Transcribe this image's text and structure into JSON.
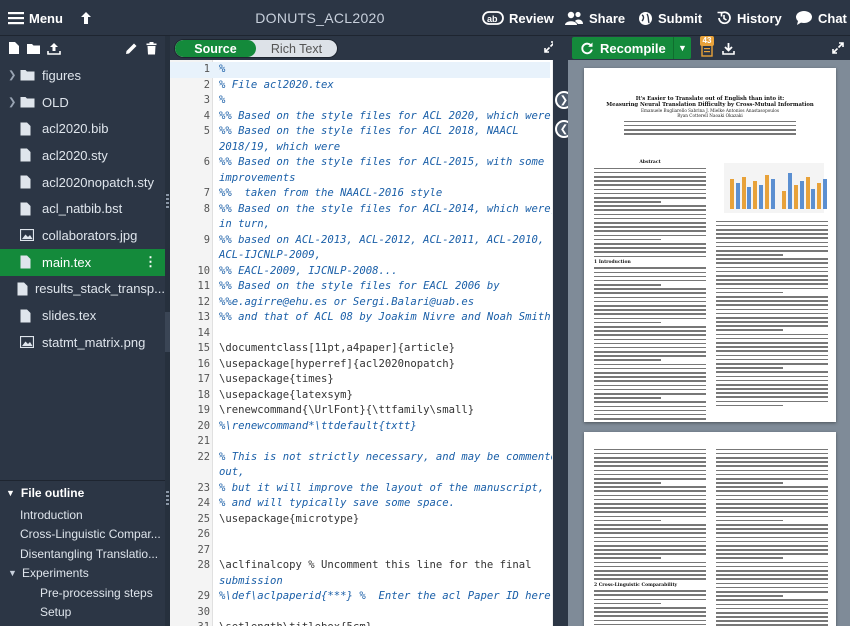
{
  "topbar": {
    "menu_label": "Menu",
    "project_title": "DONUTS_ACL2020",
    "review_label": "Review",
    "share_label": "Share",
    "submit_label": "Submit",
    "history_label": "History",
    "chat_label": "Chat"
  },
  "files": [
    {
      "name": "figures",
      "type": "folder"
    },
    {
      "name": "OLD",
      "type": "folder"
    },
    {
      "name": "acl2020.bib",
      "type": "file"
    },
    {
      "name": "acl2020.sty",
      "type": "file"
    },
    {
      "name": "acl2020nopatch.sty",
      "type": "file"
    },
    {
      "name": "acl_natbib.bst",
      "type": "file"
    },
    {
      "name": "collaborators.jpg",
      "type": "image"
    },
    {
      "name": "main.tex",
      "type": "file",
      "active": true
    },
    {
      "name": "results_stack_transp...",
      "type": "file"
    },
    {
      "name": "slides.tex",
      "type": "file"
    },
    {
      "name": "statmt_matrix.png",
      "type": "image"
    }
  ],
  "outline": {
    "title": "File outline",
    "items": [
      {
        "label": "Introduction",
        "level": 1
      },
      {
        "label": "Cross-Linguistic Compar...",
        "level": 1
      },
      {
        "label": "Disentangling Translatio...",
        "level": 1
      },
      {
        "label": "Experiments",
        "level": 1,
        "expanded": true
      },
      {
        "label": "Pre-processing steps",
        "level": 2
      },
      {
        "label": "Setup",
        "level": 2
      }
    ]
  },
  "editor": {
    "source_label": "Source",
    "rich_text_label": "Rich Text",
    "lines": [
      {
        "n": "1",
        "t": "%",
        "c": 1,
        "hl": true
      },
      {
        "n": "2",
        "t": "% File acl2020.tex",
        "c": 1
      },
      {
        "n": "3",
        "t": "%",
        "c": 1
      },
      {
        "n": "4",
        "t": "%% Based on the style files for ACL 2020, which were",
        "c": 1
      },
      {
        "n": "5",
        "t": "%% Based on the style files for ACL 2018, NAACL",
        "c": 1
      },
      {
        "n": "",
        "t": "2018/19, which were",
        "c": 1
      },
      {
        "n": "6",
        "t": "%% Based on the style files for ACL-2015, with some",
        "c": 1
      },
      {
        "n": "",
        "t": "improvements",
        "c": 1
      },
      {
        "n": "7",
        "t": "%%  taken from the NAACL-2016 style",
        "c": 1
      },
      {
        "n": "8",
        "t": "%% Based on the style files for ACL-2014, which were,",
        "c": 1
      },
      {
        "n": "",
        "t": "in turn,",
        "c": 1
      },
      {
        "n": "9",
        "t": "%% based on ACL-2013, ACL-2012, ACL-2011, ACL-2010,",
        "c": 1
      },
      {
        "n": "",
        "t": "ACL-IJCNLP-2009,",
        "c": 1
      },
      {
        "n": "10",
        "t": "%% EACL-2009, IJCNLP-2008...",
        "c": 1
      },
      {
        "n": "11",
        "t": "%% Based on the style files for EACL 2006 by",
        "c": 1
      },
      {
        "n": "12",
        "t": "%%e.agirre@ehu.es or Sergi.Balari@uab.es",
        "c": 1
      },
      {
        "n": "13",
        "t": "%% and that of ACL 08 by Joakim Nivre and Noah Smith",
        "c": 1
      },
      {
        "n": "14",
        "t": "",
        "c": 0
      },
      {
        "n": "15",
        "t": "\\documentclass[11pt,a4paper]{article}",
        "c": 0
      },
      {
        "n": "16",
        "t": "\\usepackage[hyperref]{acl2020nopatch}",
        "c": 0
      },
      {
        "n": "17",
        "t": "\\usepackage{times}",
        "c": 0
      },
      {
        "n": "18",
        "t": "\\usepackage{latexsym}",
        "c": 0
      },
      {
        "n": "19",
        "t": "\\renewcommand{\\UrlFont}{\\ttfamily\\small}",
        "c": 0
      },
      {
        "n": "20",
        "t": "%\\renewcommand*\\ttdefault{txtt}",
        "c": 1
      },
      {
        "n": "21",
        "t": "",
        "c": 0
      },
      {
        "n": "22",
        "t": "% This is not strictly necessary, and may be commented",
        "c": 1
      },
      {
        "n": "",
        "t": "out,",
        "c": 1
      },
      {
        "n": "23",
        "t": "% but it will improve the layout of the manuscript,",
        "c": 1
      },
      {
        "n": "24",
        "t": "% and will typically save some space.",
        "c": 1
      },
      {
        "n": "25",
        "t": "\\usepackage{microtype}",
        "c": 0
      },
      {
        "n": "26",
        "t": "",
        "c": 0
      },
      {
        "n": "27",
        "t": "",
        "c": 0
      },
      {
        "n": "28",
        "t": "\\aclfinalcopy % Uncomment this line for the final",
        "c": 2
      },
      {
        "n": "",
        "t": "submission",
        "c": 1
      },
      {
        "n": "29",
        "t": "%\\def\\aclpaperid{***} %  Enter the acl Paper ID here",
        "c": 1
      },
      {
        "n": "30",
        "t": "",
        "c": 0
      },
      {
        "n": "31",
        "t": "\\setlength\\titlebox{5cm}",
        "c": 0
      }
    ]
  },
  "pdf": {
    "recompile_label": "Recompile",
    "log_count": "43",
    "title_line1": "It's Easier to Translate out of English than into it:",
    "title_line2": "Measuring Neural Translation Difficulty by Cross-Mutual Information",
    "authors_line": "Emanuele Bugliarello  Sabrina J. Mielke  Antonios Anastasopoulos",
    "authors_line2": "Ryan Cotterell  Naoaki Okazaki",
    "abstract_heading": "Abstract",
    "intro_heading": "1   Introduction",
    "section2_heading": "2   Cross-Linguistic Comparability"
  }
}
